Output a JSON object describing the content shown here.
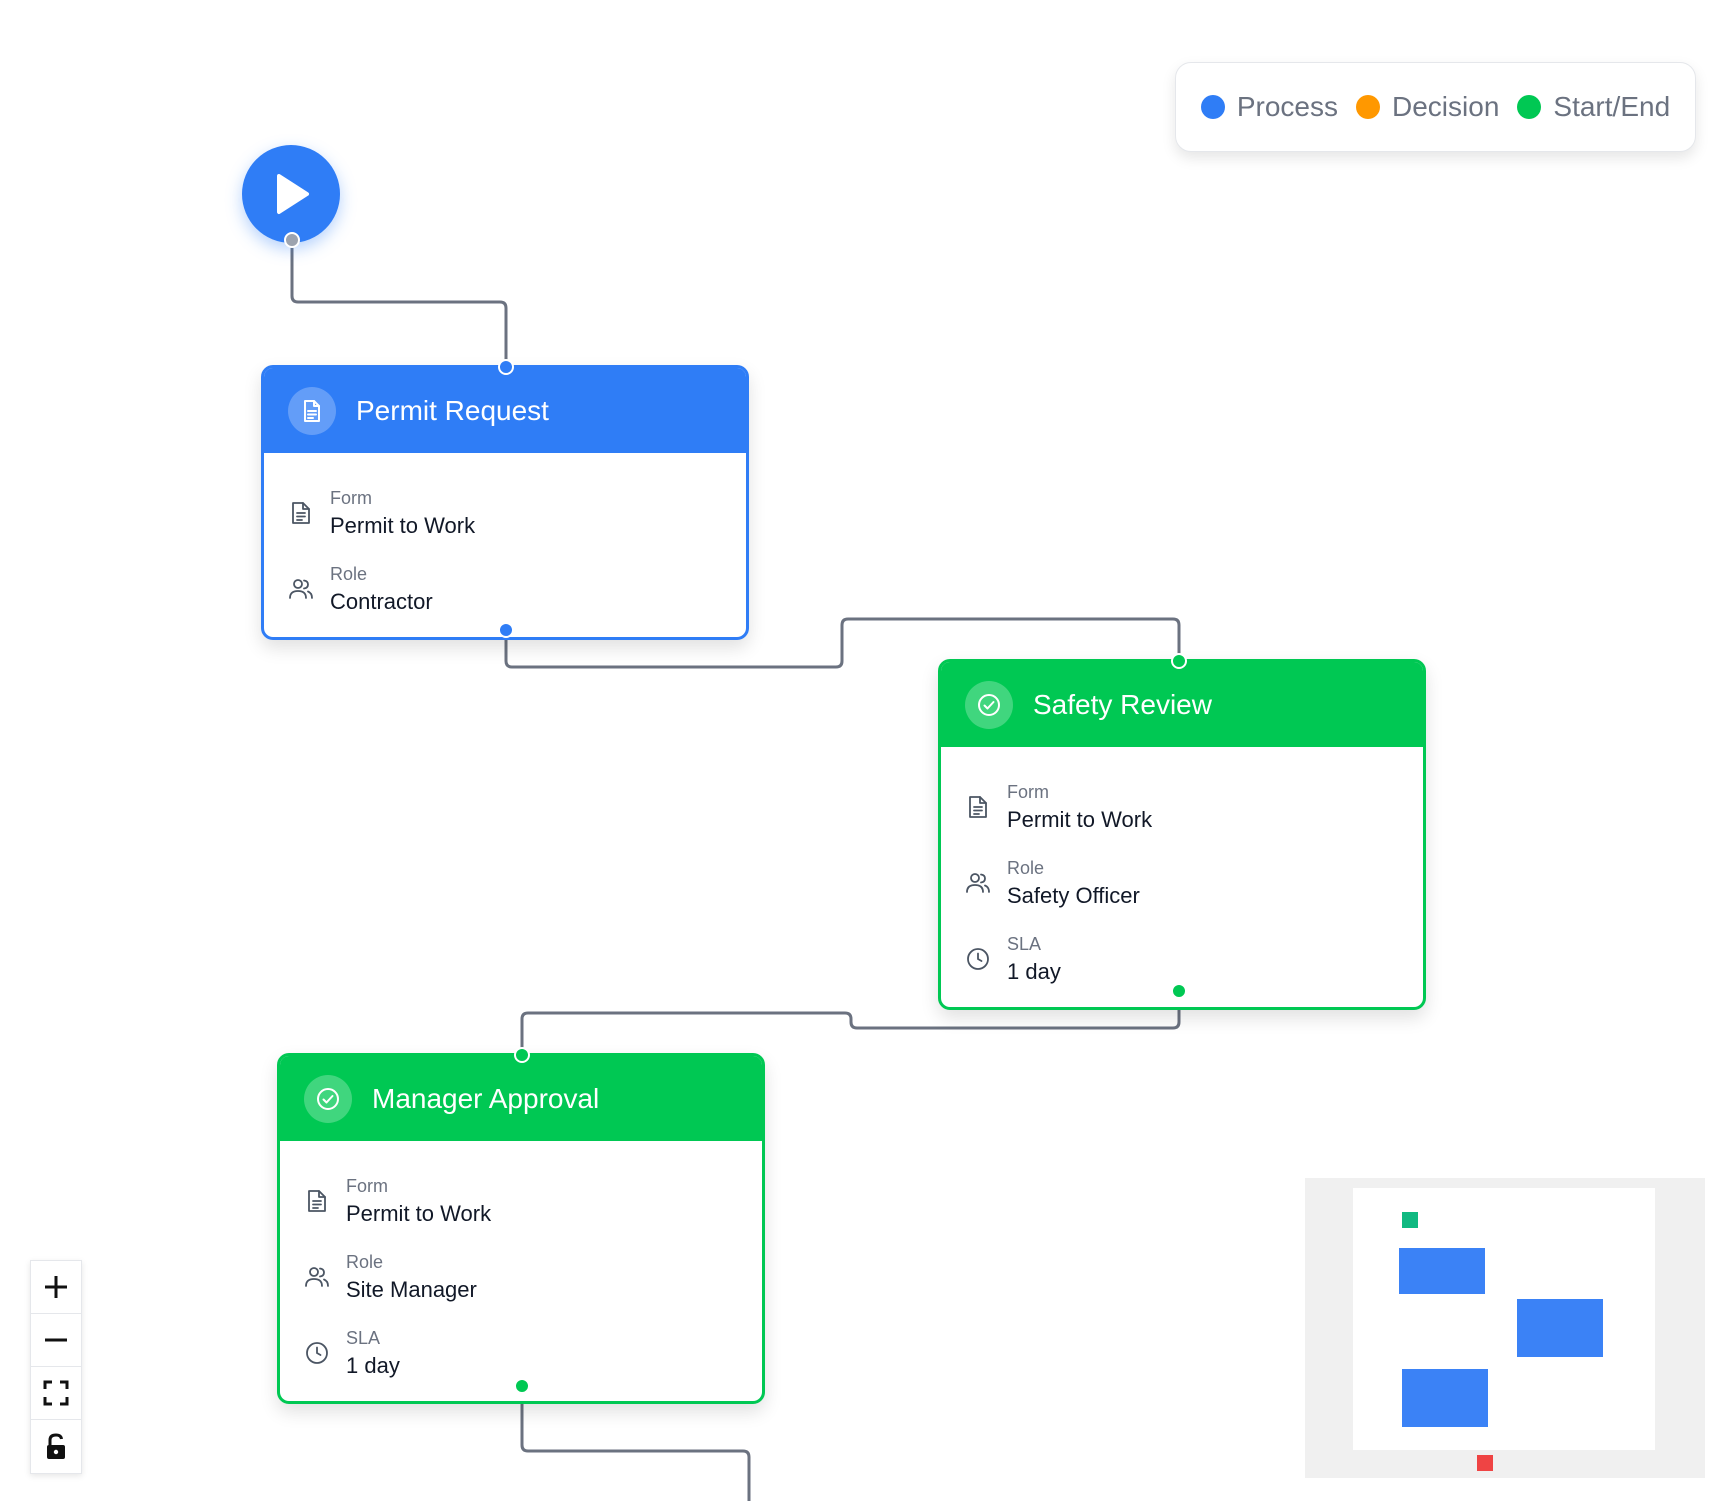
{
  "legend": {
    "items": [
      {
        "label": "Process",
        "color": "#2f7df6"
      },
      {
        "label": "Decision",
        "color": "#ff9800"
      },
      {
        "label": "Start/End",
        "color": "#00c853"
      }
    ]
  },
  "start_node": {
    "icon": "play-icon",
    "color": "#2f7df6"
  },
  "nodes": [
    {
      "title": "Permit Request",
      "theme": "blue",
      "header_icon": "document-icon",
      "fields": [
        {
          "icon": "form-icon",
          "label": "Form",
          "value": "Permit to Work"
        },
        {
          "icon": "role-icon",
          "label": "Role",
          "value": "Contractor"
        }
      ]
    },
    {
      "title": "Safety Review",
      "theme": "green",
      "header_icon": "check-circle-icon",
      "fields": [
        {
          "icon": "form-icon",
          "label": "Form",
          "value": "Permit to Work"
        },
        {
          "icon": "role-icon",
          "label": "Role",
          "value": "Safety Officer"
        },
        {
          "icon": "clock-icon",
          "label": "SLA",
          "value": "1 day"
        }
      ]
    },
    {
      "title": "Manager Approval",
      "theme": "green",
      "header_icon": "check-circle-icon",
      "fields": [
        {
          "icon": "form-icon",
          "label": "Form",
          "value": "Permit to Work"
        },
        {
          "icon": "role-icon",
          "label": "Role",
          "value": "Site Manager"
        },
        {
          "icon": "clock-icon",
          "label": "SLA",
          "value": "1 day"
        }
      ]
    }
  ],
  "controls": [
    {
      "icon": "zoom-in-icon"
    },
    {
      "icon": "zoom-out-icon"
    },
    {
      "icon": "fit-view-icon"
    },
    {
      "icon": "lock-icon"
    }
  ],
  "minimap": {
    "node_color": "#3b82f6",
    "start_color": "#10b981",
    "end_color": "#ef4444"
  },
  "colors": {
    "edge": "#6b7280",
    "process": "#2f7df6",
    "approval": "#00c853"
  }
}
